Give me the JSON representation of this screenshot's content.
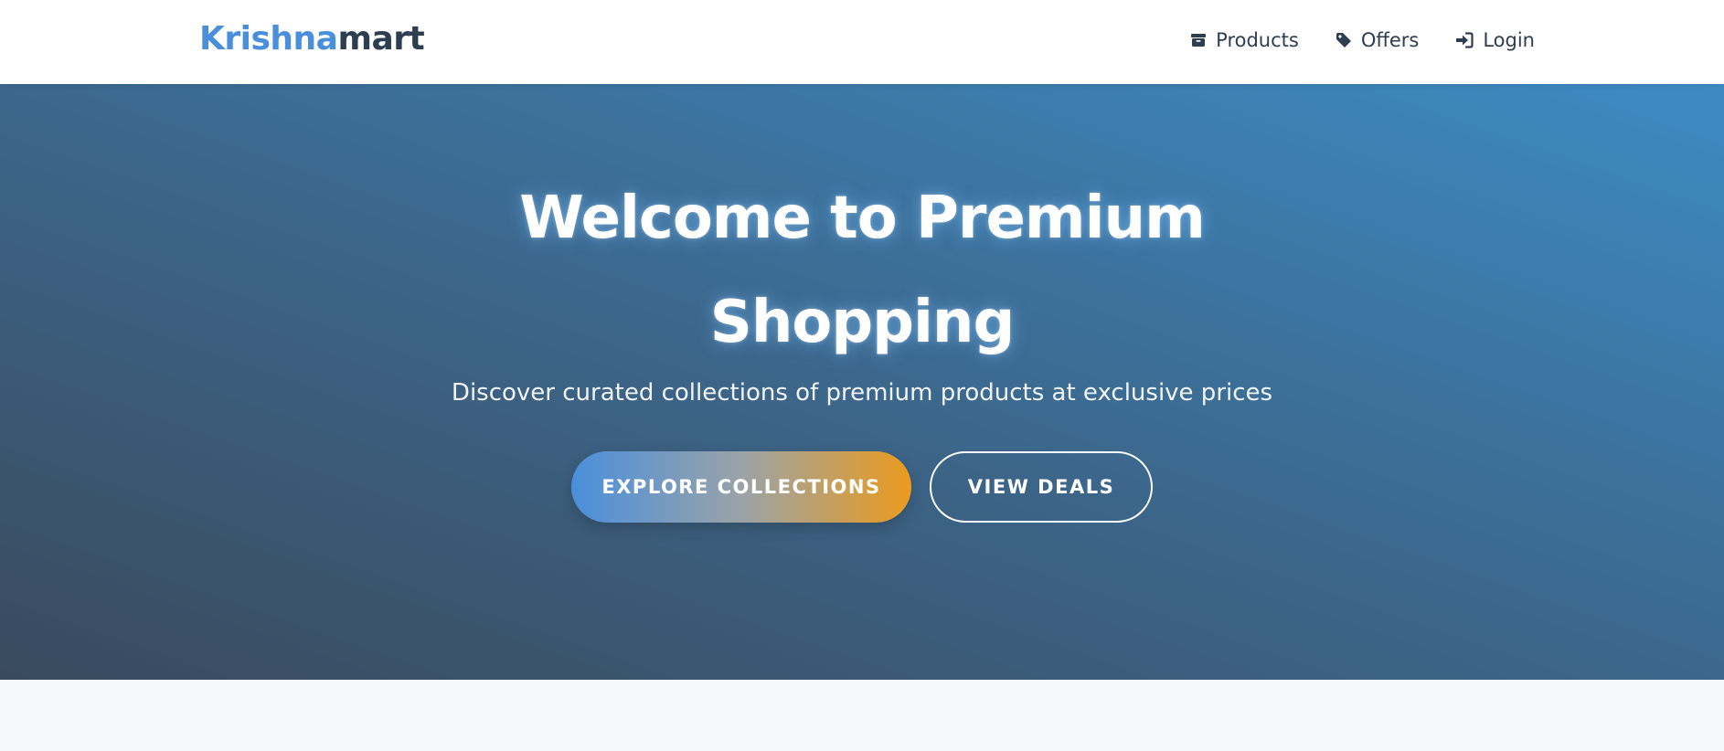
{
  "brand": {
    "part1": "Krishna",
    "part2": "mart"
  },
  "nav": {
    "items": [
      {
        "label": "Products",
        "icon": "box-icon"
      },
      {
        "label": "Offers",
        "icon": "tag-icon"
      },
      {
        "label": "Login",
        "icon": "sign-in-icon"
      }
    ]
  },
  "hero": {
    "title_line1": "Welcome to Premium",
    "title_line2": "Shopping",
    "subtitle": "Discover curated collections of premium products at exclusive prices",
    "primary_button": "EXPLORE COLLECTIONS",
    "secondary_button": "VIEW DEALS"
  },
  "colors": {
    "brand_accent": "#4a8fdc",
    "brand_dark": "#2c3e50",
    "cta_orange": "#eb9b1d",
    "hero_start": "#394a5d",
    "hero_end": "#3d8bc3"
  }
}
